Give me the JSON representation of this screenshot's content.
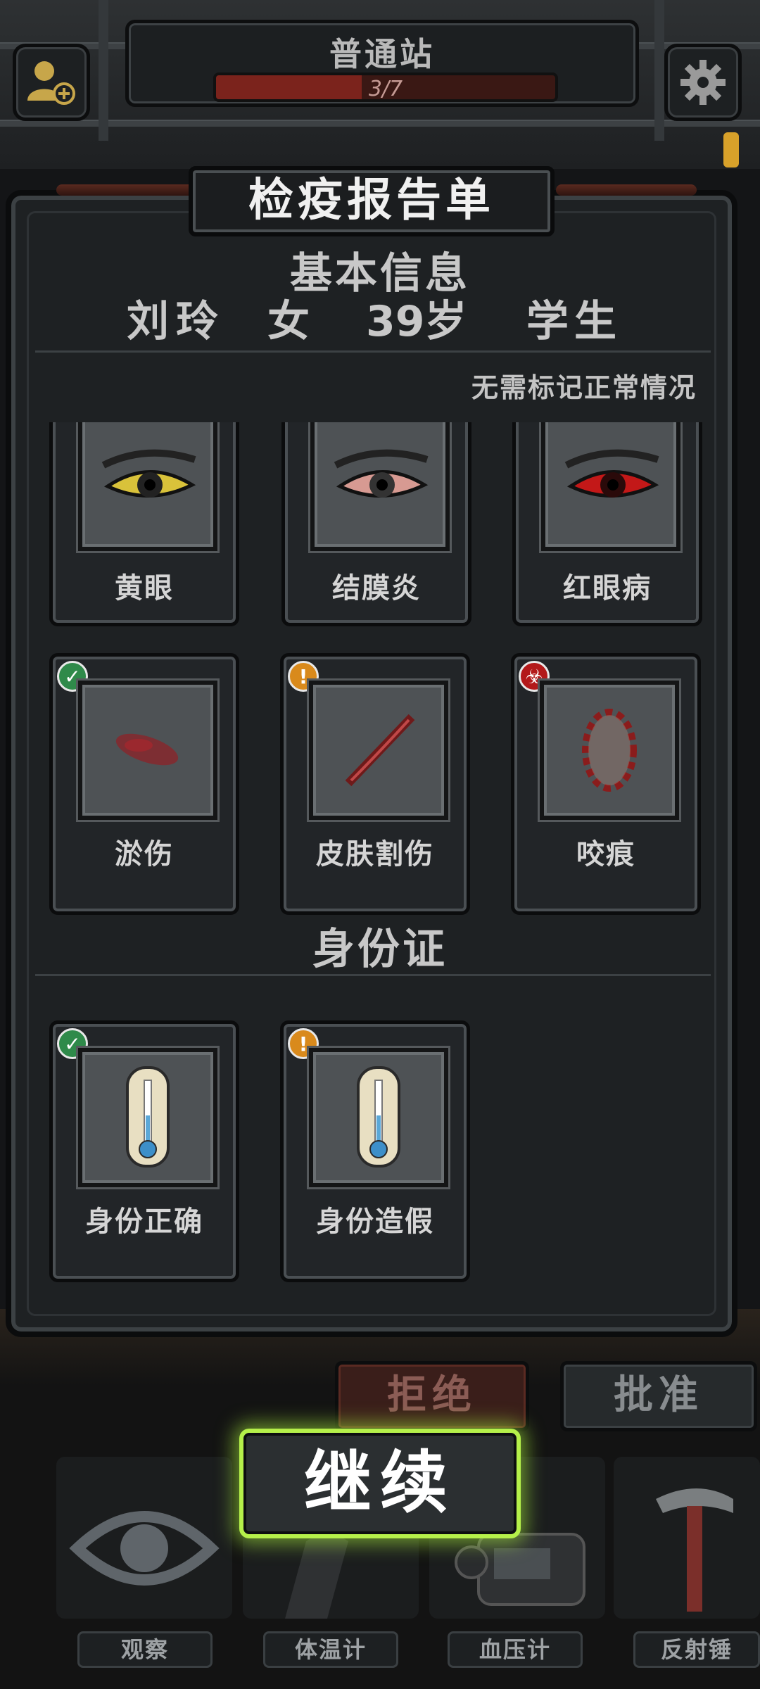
{
  "header": {
    "station_name": "普通站",
    "progress_text": "3/7",
    "progress_fraction": 0.43,
    "left_icon": "add-person-icon",
    "right_icon": "gear-icon"
  },
  "report": {
    "title": "检疫报告单",
    "basic_info_heading": "基本信息",
    "person": {
      "name": "刘玲",
      "gender": "女",
      "age": "39岁",
      "occupation": "学生"
    },
    "hint": "无需标记正常情况",
    "symptoms": [
      {
        "label": "黄眼",
        "icon": "yellow-eye-icon",
        "badge": null
      },
      {
        "label": "结膜炎",
        "icon": "conjunctivitis-eye-icon",
        "badge": null
      },
      {
        "label": "红眼病",
        "icon": "red-eye-icon",
        "badge": null
      },
      {
        "label": "淤伤",
        "icon": "bruise-icon",
        "badge": "check-icon"
      },
      {
        "label": "皮肤割伤",
        "icon": "skin-cut-icon",
        "badge": "warning-icon"
      },
      {
        "label": "咬痕",
        "icon": "bite-mark-icon",
        "badge": "biohazard-icon"
      }
    ],
    "id_heading": "身份证",
    "id_checks": [
      {
        "label": "身份正确",
        "icon": "thermometer-icon",
        "badge": "check-icon"
      },
      {
        "label": "身份造假",
        "icon": "thermometer-icon",
        "badge": "warning-icon"
      }
    ]
  },
  "actions": {
    "reject": "拒绝",
    "approve": "批准",
    "continue": "继续"
  },
  "tools": [
    {
      "label": "观察",
      "icon": "eye-icon"
    },
    {
      "label": "体温计",
      "icon": "thermometer-gun-icon"
    },
    {
      "label": "血压计",
      "icon": "blood-pressure-monitor-icon"
    },
    {
      "label": "反射锤",
      "icon": "reflex-hammer-icon"
    }
  ],
  "colors": {
    "continue_glow": "#b5f04a",
    "badge_ok": "#2f8a4a",
    "badge_warn": "#d98a1c",
    "badge_bio": "#b3191a"
  }
}
